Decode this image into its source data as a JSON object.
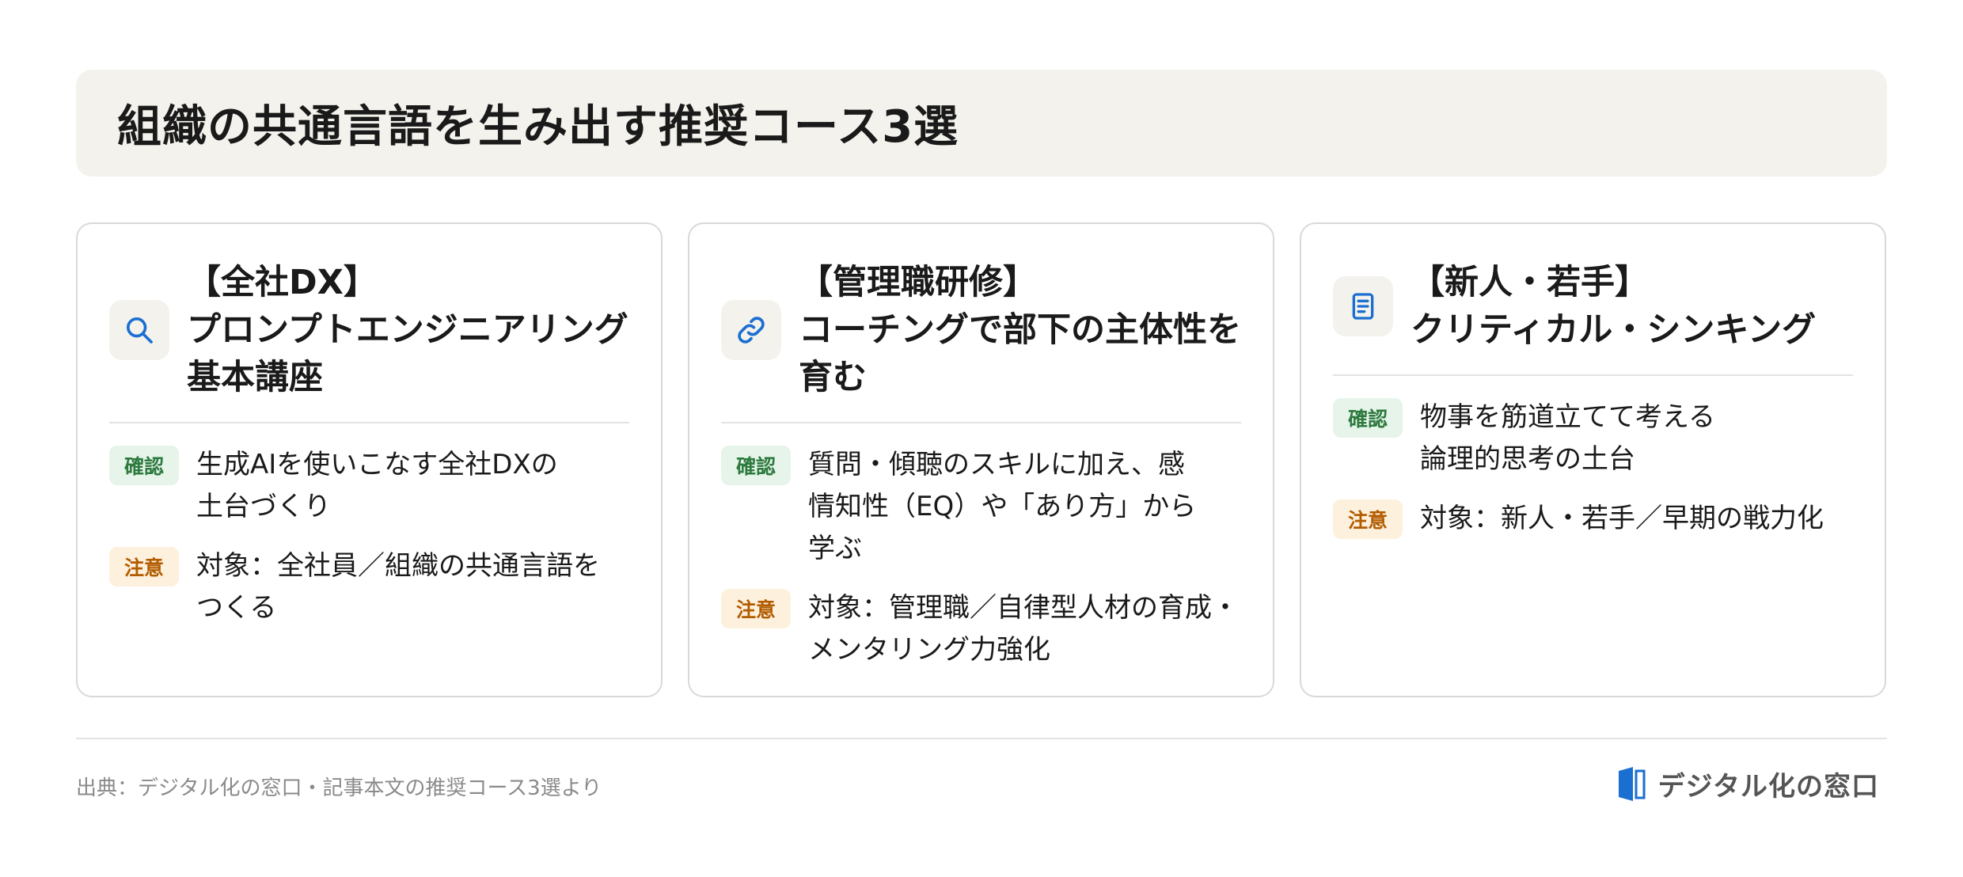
{
  "header": {
    "title": "組織の共通言語を生み出す推奨コース3選"
  },
  "cards": [
    {
      "icon": "search-icon",
      "title_lines": [
        "【全社DX】",
        "プロンプトエンジニアリング",
        "基本講座"
      ],
      "confirm_tag": "確認",
      "confirm_lines": [
        "生成AIを使いこなす全社DXの",
        "土台づくり"
      ],
      "caution_tag": "注意",
      "caution_lines": [
        "対象：全社員／組織の共通言語を",
        "つくる"
      ]
    },
    {
      "icon": "link-icon",
      "title_lines": [
        "【管理職研修】",
        "コーチングで部下の主体性を",
        "育む"
      ],
      "confirm_tag": "確認",
      "confirm_lines": [
        "質問・傾聴のスキルに加え、感",
        "情知性（EQ）や「あり方」から",
        "学ぶ"
      ],
      "caution_tag": "注意",
      "caution_lines": [
        "対象：管理職／自律型人材の育成・",
        "メンタリング力強化"
      ]
    },
    {
      "icon": "document-icon",
      "title_lines": [
        "【新人・若手】",
        "クリティカル・シンキング"
      ],
      "confirm_tag": "確認",
      "confirm_lines": [
        "物事を筋道立てて考える",
        "論理的思考の土台"
      ],
      "caution_tag": "注意",
      "caution_lines": [
        "対象：新人・若手／早期の戦力化"
      ]
    }
  ],
  "footer": {
    "source": "出典：デジタル化の窓口・記事本文の推奨コース3選より",
    "brand": "デジタル化の窓口"
  },
  "colors": {
    "header_bg": "#f4f2ec",
    "confirm_bg": "#e6f4ea",
    "confirm_text": "#2d7a3e",
    "caution_bg": "#fdf0dd",
    "caution_text": "#b25c00",
    "icon_blue": "#1a6fd1"
  }
}
